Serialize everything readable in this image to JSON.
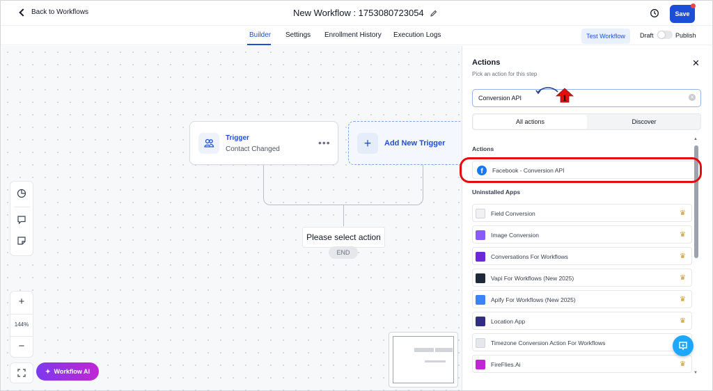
{
  "header": {
    "back_label": "Back to Workflows",
    "title": "New Workflow : 1753080723054",
    "save_label": "Save"
  },
  "tabs": [
    {
      "label": "Builder",
      "active": true
    },
    {
      "label": "Settings"
    },
    {
      "label": "Enrollment History"
    },
    {
      "label": "Execution Logs"
    }
  ],
  "toolbar": {
    "test_label": "Test Workflow",
    "draft_label": "Draft",
    "publish_label": "Publish"
  },
  "canvas": {
    "trigger_title": "Trigger",
    "trigger_subtitle": "Contact Changed",
    "add_trigger_label": "Add New Trigger",
    "select_action_label": "Please select action",
    "end_label": "END",
    "zoom_level": "144%",
    "ai_label": "Workflow AI"
  },
  "panel": {
    "title": "Actions",
    "subtitle": "Pick an action for this step",
    "search_value": "Conversion API",
    "segment_all": "All actions",
    "segment_discover": "Discover",
    "section_actions": "Actions",
    "facebook_item": "Facebook - Conversion API",
    "section_uninstalled": "Uninstalled Apps",
    "apps": [
      {
        "label": "Field Conversion",
        "icon": "field-conversion-icon",
        "color": "#f1f1f3"
      },
      {
        "label": "Image Conversion",
        "icon": "image-conversion-icon",
        "color": "#8a5cf6"
      },
      {
        "label": "Conversations For Workflows",
        "icon": "conversations-icon",
        "color": "#6d28d9"
      },
      {
        "label": "Vapi For Workflows (New 2025)",
        "icon": "vapi-icon",
        "color": "#1e293b"
      },
      {
        "label": "Apify For Workflows (New 2025)",
        "icon": "apify-icon",
        "color": "#3b82f6"
      },
      {
        "label": "Location App",
        "icon": "location-app-icon",
        "color": "#312e81"
      },
      {
        "label": "Timezone Conversion Action For Workflows",
        "icon": "timezone-icon",
        "color": "#e5e7eb"
      },
      {
        "label": "FireFlies.Ai",
        "icon": "fireflies-icon",
        "color": "#c026d3"
      }
    ]
  },
  "annotation": {
    "step_number": "1",
    "color": "#e40d0d"
  },
  "colors": {
    "accent": "#1d4ed8",
    "facebook": "#1877f2",
    "premium": "#c99a2e"
  }
}
